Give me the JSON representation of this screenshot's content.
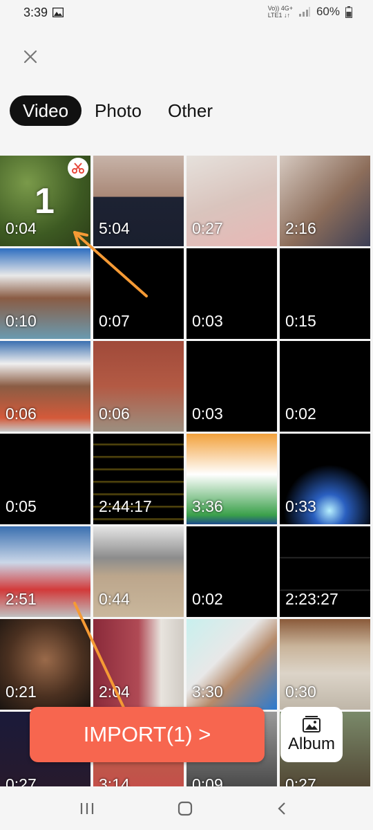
{
  "status_bar": {
    "time": "3:39",
    "network_top": "Vo)) 4G+",
    "network_bottom": "LTE1 ↓↑",
    "battery": "60%"
  },
  "header": {
    "close_icon": "close-icon"
  },
  "tabs": [
    {
      "label": "Video",
      "active": true
    },
    {
      "label": "Photo",
      "active": false
    },
    {
      "label": "Other",
      "active": false
    }
  ],
  "videos": [
    {
      "duration": "0:04",
      "selected": true,
      "selection_number": "1"
    },
    {
      "duration": "5:04"
    },
    {
      "duration": "0:27"
    },
    {
      "duration": "2:16"
    },
    {
      "duration": "0:10"
    },
    {
      "duration": "0:07"
    },
    {
      "duration": "0:03"
    },
    {
      "duration": "0:15"
    },
    {
      "duration": "0:06"
    },
    {
      "duration": "0:06"
    },
    {
      "duration": "0:03"
    },
    {
      "duration": "0:02"
    },
    {
      "duration": "0:05"
    },
    {
      "duration": "2:44:17"
    },
    {
      "duration": "3:36"
    },
    {
      "duration": "0:33"
    },
    {
      "duration": "2:51"
    },
    {
      "duration": "0:44"
    },
    {
      "duration": "0:02"
    },
    {
      "duration": "2:23:27"
    },
    {
      "duration": "0:21"
    },
    {
      "duration": "2:04"
    },
    {
      "duration": "3:30"
    },
    {
      "duration": "0:30"
    },
    {
      "duration": "0:27"
    },
    {
      "duration": "3:14"
    },
    {
      "duration": "0:09"
    },
    {
      "duration": "0:27"
    }
  ],
  "actions": {
    "import_label": "IMPORT(1) >",
    "album_label": "Album"
  },
  "colors": {
    "accent": "#f7664f",
    "active_tab": "#111111",
    "arrow": "#f59a35"
  }
}
